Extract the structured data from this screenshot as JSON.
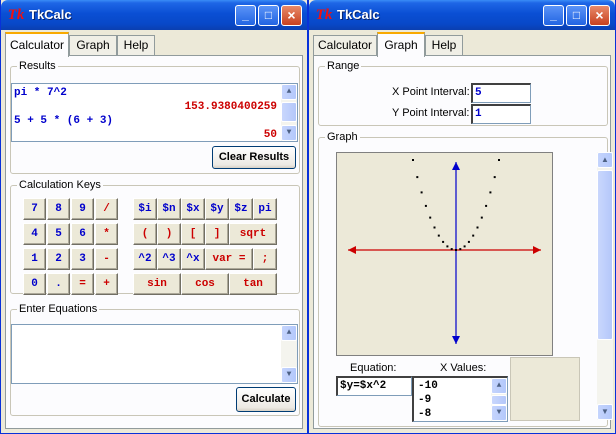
{
  "left_window": {
    "title": "TkCalc",
    "icon": "tk-logo",
    "tabs": [
      {
        "label": "Calculator",
        "active": true
      },
      {
        "label": "Graph",
        "active": false
      },
      {
        "label": "Help",
        "active": false
      }
    ],
    "results": {
      "legend": "Results",
      "lines": [
        {
          "text": "pi * 7^2",
          "kind": "input"
        },
        {
          "text": "153.9380400259",
          "kind": "output"
        },
        {
          "text": "5 + 5 * (6 + 3)",
          "kind": "input"
        },
        {
          "text": "50",
          "kind": "output"
        }
      ],
      "clear_button": "Clear Results"
    },
    "keys": {
      "legend": "Calculation Keys",
      "numeric": [
        "7",
        "8",
        "9",
        "/",
        "4",
        "5",
        "6",
        "*",
        "1",
        "2",
        "3",
        "-",
        "0",
        ".",
        "=",
        "+"
      ],
      "func_row1": [
        "$i",
        "$n",
        "$x",
        "$y",
        "$z",
        "pi"
      ],
      "func_row2": [
        "(",
        ")",
        "[",
        "]",
        "sqrt"
      ],
      "func_row3": [
        "^2",
        "^3",
        "^x",
        "var =",
        ";"
      ],
      "func_row4": [
        "sin",
        "cos",
        "tan"
      ]
    },
    "equations": {
      "legend": "Enter Equations",
      "value": "",
      "calculate_button": "Calculate"
    }
  },
  "right_window": {
    "title": "TkCalc",
    "icon": "tk-logo",
    "tabs": [
      {
        "label": "Calculator",
        "active": false
      },
      {
        "label": "Graph",
        "active": true
      },
      {
        "label": "Help",
        "active": false
      }
    ],
    "range": {
      "legend": "Range",
      "x_label": "X Point Interval:",
      "x_value": "5",
      "y_label": "Y Point Interval:",
      "y_value": "1"
    },
    "graph": {
      "legend": "Graph",
      "equation_label": "Equation:",
      "equation_value": "$y=$x^2",
      "xvalues_label": "X Values:",
      "xvalues": [
        "-10",
        "-9",
        "-8"
      ],
      "axis_color": "#cc0000",
      "y_axis_color": "#0000cc"
    }
  },
  "chart_data": {
    "type": "scatter",
    "title": "",
    "xlabel": "",
    "ylabel": "",
    "x": [
      -10,
      -9,
      -8,
      -7,
      -6,
      -5,
      -4,
      -3,
      -2,
      -1,
      0,
      1,
      2,
      3,
      4,
      5,
      6,
      7,
      8,
      9,
      10
    ],
    "y": [
      100,
      81,
      64,
      49,
      36,
      25,
      16,
      9,
      4,
      1,
      0,
      1,
      4,
      9,
      16,
      25,
      36,
      49,
      64,
      81,
      100
    ],
    "xlim": [
      -10,
      10
    ],
    "ylim": [
      -100,
      100
    ],
    "grid": false
  }
}
